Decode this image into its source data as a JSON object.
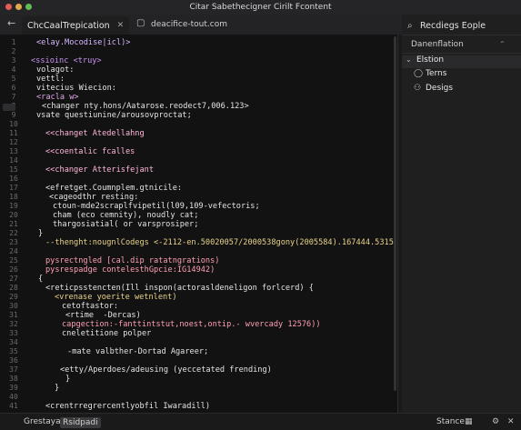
{
  "window": {
    "title": "Citar Sabethecigner Cirilt Fcontent"
  },
  "traffic_colors": [
    "#e25d57",
    "#e2a94b",
    "#5fbd54"
  ],
  "tabbar": {
    "tab_label": "ChcCaalTrepication",
    "path": "deacifice-tout.com"
  },
  "right_panel": {
    "search_text": "Recdiegs Eople",
    "section_label": "Danenflation",
    "items": [
      {
        "label": "Elstion",
        "icon": "chevron-down-icon"
      },
      {
        "label": "Terns",
        "icon": "circle-outline-icon"
      },
      {
        "label": "Desigs",
        "icon": "people-icon"
      }
    ]
  },
  "editor": {
    "line_numbers": [
      "1",
      "2",
      "3",
      "4",
      "5",
      "6",
      "7",
      "8",
      "9",
      "10",
      "11",
      "12",
      "13",
      "14",
      "15",
      "16",
      "17",
      "18",
      "19",
      "20",
      "21",
      "22",
      "23",
      "24",
      "25",
      "26",
      "27",
      "28",
      "29",
      "30",
      "31",
      "32",
      "33",
      "34",
      "35",
      "36",
      "37",
      "38",
      "39",
      "40",
      "41"
    ],
    "lines": [
      {
        "text": "<elay.Mocodise|icl)>",
        "color": "#d6b8ff",
        "indent": 40
      },
      {
        "text": "",
        "color": "#cfcfcf",
        "indent": 0
      },
      {
        "text": "<ssioinc <truy>",
        "color": "#c892f2",
        "indent": 34
      },
      {
        "text": "volagot:",
        "color": "#e4e4e4",
        "indent": 40
      },
      {
        "text": "vettl:",
        "color": "#e4e4e4",
        "indent": 40
      },
      {
        "text": "vitecius Wiecion:",
        "color": "#e4e4e4",
        "indent": 40
      },
      {
        "text": "<racla w>",
        "color": "#e0a6e8",
        "indent": 40
      },
      {
        "text": "<changer nty.hons/Aatarose.reodect7,006.123>",
        "color": "#e4e4e4",
        "indent": 46
      },
      {
        "text": "vsate questiunine/arousovproctat;",
        "color": "#e4e4e4",
        "indent": 40
      },
      {
        "text": "",
        "color": "#cfcfcf",
        "indent": 0
      },
      {
        "text": "<<changet Atedellahng",
        "color": "#ffb7d9",
        "indent": 50
      },
      {
        "text": "",
        "color": "#cfcfcf",
        "indent": 0
      },
      {
        "text": "<<coentalic fcalles",
        "color": "#ffb7d9",
        "indent": 50
      },
      {
        "text": "",
        "color": "#cfcfcf",
        "indent": 0
      },
      {
        "text": "<<changer Atterisfejant",
        "color": "#ffb7d9",
        "indent": 50
      },
      {
        "text": "",
        "color": "#cfcfcf",
        "indent": 0
      },
      {
        "text": "<efretget.Coumnplem.gtnicile:",
        "color": "#e4e4e4",
        "indent": 50
      },
      {
        "text": "<cageodthr resting:",
        "color": "#e4e4e4",
        "indent": 54
      },
      {
        "text": "ctoun-mde2scraplfvipetil(l09,109-vefectoris;",
        "color": "#e4e4e4",
        "indent": 58
      },
      {
        "text": "cham (eco cemnity), noudly cat;",
        "color": "#e4e4e4",
        "indent": 58
      },
      {
        "text": "thargosiatial( or varsprosiper;",
        "color": "#e4e4e4",
        "indent": 58
      },
      {
        "text": "}",
        "color": "#e4e4e4",
        "indent": 42
      },
      {
        "text": "--thenght:nougnlCodegs <-2112-en.50020057/2000538gony(2005584).167444.5315;",
        "color": "#e8d38a",
        "indent": 50
      },
      {
        "text": "",
        "color": "#cfcfcf",
        "indent": 0
      },
      {
        "text": "pysrectngled [cal.dip ratatngrations)",
        "color": "#ff9fb4",
        "indent": 50
      },
      {
        "text": "pysrespadge contelesthGpcie:IG14942)",
        "color": "#ff9fb4",
        "indent": 50
      },
      {
        "text": "{",
        "color": "#e4e4e4",
        "indent": 42
      },
      {
        "text": "<reticpsstencten(Ill inspon(actorasldeneligon forlcerd) {",
        "color": "#e4e4e4",
        "indent": 50
      },
      {
        "text": "<vrenase yoerite wetnlent)",
        "color": "#e8d38a",
        "indent": 60
      },
      {
        "text": "cetoftastor:",
        "color": "#e4e4e4",
        "indent": 68
      },
      {
        "text": "<rtime  -Dercas)",
        "color": "#e4e4e4",
        "indent": 72
      },
      {
        "text": "capgection:-fanttintstut,noest,ontip.- wvercady 12576))",
        "color": "#ff9fb4",
        "indent": 68
      },
      {
        "text": "cneletitione polper",
        "color": "#e4e4e4",
        "indent": 68
      },
      {
        "text": "",
        "color": "#cfcfcf",
        "indent": 0
      },
      {
        "text": "-mate valbther-Dortad Agareer;",
        "color": "#e4e4e4",
        "indent": 74
      },
      {
        "text": "",
        "color": "#cfcfcf",
        "indent": 0
      },
      {
        "text": "<etty/Aperdoes/adeusing (yeccetated frending)",
        "color": "#e4e4e4",
        "indent": 66
      },
      {
        "text": "}",
        "color": "#e4e4e4",
        "indent": 72
      },
      {
        "text": "}",
        "color": "#e4e4e4",
        "indent": 60
      },
      {
        "text": "",
        "color": "#cfcfcf",
        "indent": 0
      },
      {
        "text": "<crentrregrercentlyobfil Iwaradill)",
        "color": "#e4e4e4",
        "indent": 50
      }
    ]
  },
  "statusbar": {
    "left_label": "Grestaya",
    "badge_label": "Rsidpadi",
    "right_label": "Stance"
  }
}
